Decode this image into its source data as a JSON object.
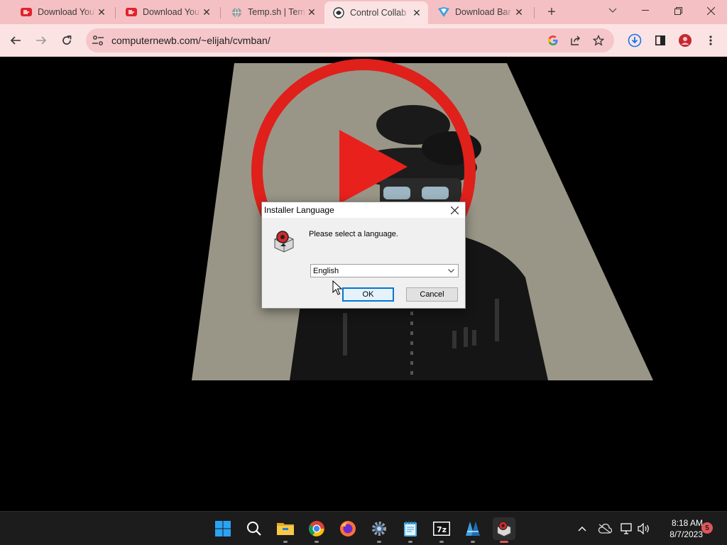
{
  "browser": {
    "tabs": [
      {
        "title": "Download YouTube",
        "favicon": "youtube-downloader-icon",
        "active": false
      },
      {
        "title": "Download YouTube",
        "favicon": "youtube-downloader-icon",
        "active": false
      },
      {
        "title": "Temp.sh | Temp",
        "favicon": "globe-icon",
        "active": false
      },
      {
        "title": "Control Collab",
        "favicon": "collab-icon",
        "active": true
      },
      {
        "title": "Download Bar",
        "favicon": "download-bar-icon",
        "active": false
      }
    ],
    "address": "computernewb.com/~elijah/cvmban/"
  },
  "dialog": {
    "title": "Installer Language",
    "prompt": "Please select a language.",
    "selected_language": "English",
    "ok_label": "OK",
    "cancel_label": "Cancel"
  },
  "taskbar": {
    "apps": [
      "start-icon",
      "search-icon",
      "file-explorer-icon",
      "chrome-icon",
      "firefox-icon",
      "settings-icon",
      "notepad-icon",
      "7zip-icon",
      "mediaplayer-icon",
      "installer-icon"
    ],
    "time": "8:18 AM",
    "date": "8/7/2023",
    "notification_count": "5"
  },
  "colors": {
    "accent": "#e0565b",
    "tabbar": "#f5c0c3",
    "toolbar": "#fbe3e4"
  }
}
